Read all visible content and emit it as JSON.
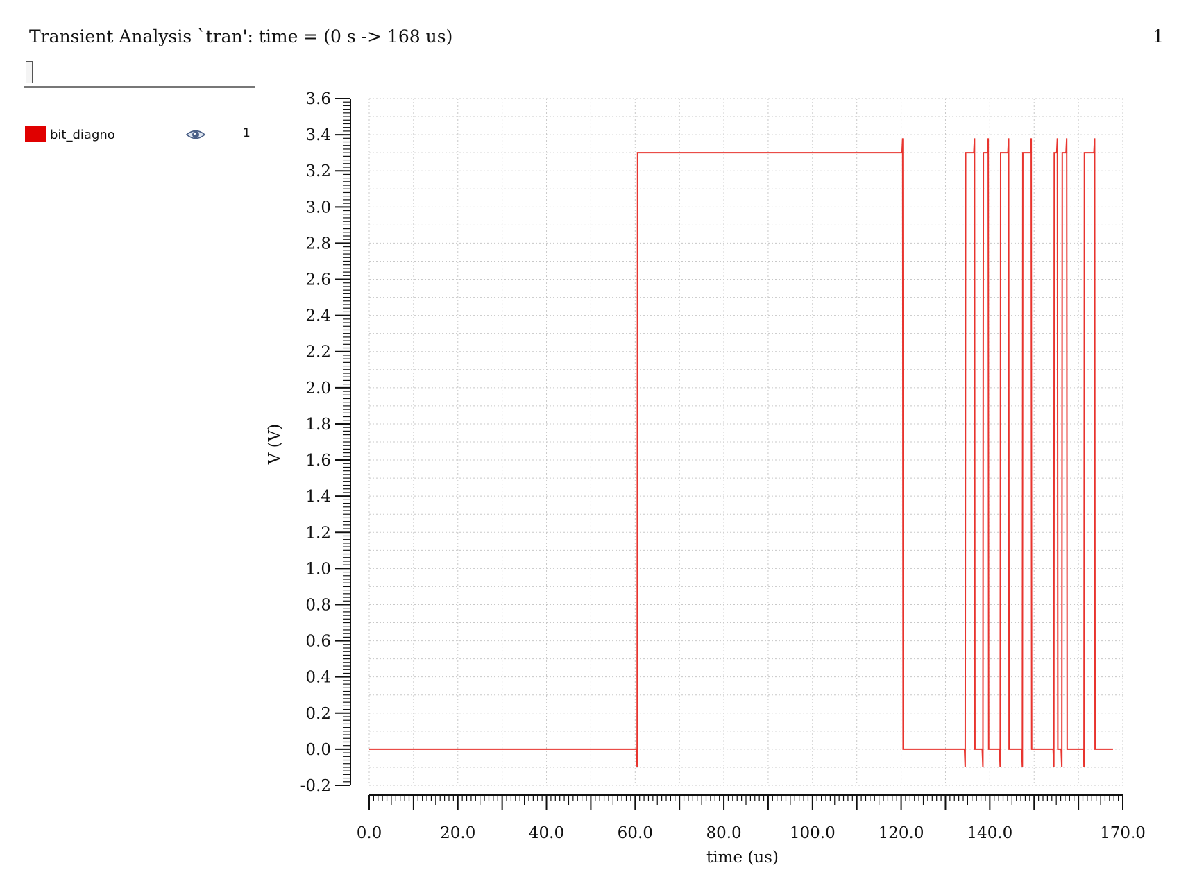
{
  "header": {
    "title": "Transient Analysis `tran': time = (0 s -> 168 us)",
    "page_number": "1"
  },
  "legend": {
    "label": "bit_diagno",
    "index": "1",
    "icon": "eye-icon",
    "color": "#e00000"
  },
  "colors": {
    "trace": "#e8342e",
    "grid": "#c8c8c8",
    "axis": "#111111"
  },
  "chart_data": {
    "type": "line",
    "xlabel": "time (us)",
    "ylabel": "V (V)",
    "xlim": [
      0,
      170
    ],
    "ylim": [
      -0.2,
      3.6
    ],
    "x_ticks": [
      {
        "value": 0,
        "label": "0.0"
      },
      {
        "value": 20,
        "label": "20.0"
      },
      {
        "value": 40,
        "label": "40.0"
      },
      {
        "value": 60,
        "label": "60.0"
      },
      {
        "value": 80,
        "label": "80.0"
      },
      {
        "value": 100,
        "label": "100.0"
      },
      {
        "value": 120,
        "label": "120.0"
      },
      {
        "value": 140,
        "label": "140.0"
      },
      {
        "value": 170,
        "label": "170.0"
      }
    ],
    "y_ticks": [
      {
        "value": 3.6,
        "label": "3.6"
      },
      {
        "value": 3.4,
        "label": "3.4"
      },
      {
        "value": 3.2,
        "label": "3.2"
      },
      {
        "value": 3.0,
        "label": "3.0"
      },
      {
        "value": 2.8,
        "label": "2.8"
      },
      {
        "value": 2.6,
        "label": "2.6"
      },
      {
        "value": 2.4,
        "label": "2.4"
      },
      {
        "value": 2.2,
        "label": "2.2"
      },
      {
        "value": 2.0,
        "label": "2.0"
      },
      {
        "value": 1.8,
        "label": "1.8"
      },
      {
        "value": 1.6,
        "label": "1.6"
      },
      {
        "value": 1.4,
        "label": "1.4"
      },
      {
        "value": 1.2,
        "label": "1.2"
      },
      {
        "value": 1.0,
        "label": "1.0"
      },
      {
        "value": 0.8,
        "label": "0.8"
      },
      {
        "value": 0.6,
        "label": "0.6"
      },
      {
        "value": 0.4,
        "label": "0.4"
      },
      {
        "value": 0.2,
        "label": "0.2"
      },
      {
        "value": 0.0,
        "label": "0.0"
      },
      {
        "value": -0.2,
        "label": "-0.2"
      }
    ],
    "grid": true,
    "series": [
      {
        "name": "bit_diagno",
        "x": [
          0,
          60.3,
          60.45,
          60.55,
          60.7,
          120.2,
          120.35,
          120.45,
          120.6,
          134.3,
          134.45,
          134.55,
          134.7,
          136.4,
          136.55,
          136.65,
          136.8,
          138.3,
          138.45,
          138.55,
          138.7,
          139.5,
          139.65,
          139.75,
          139.9,
          142.2,
          142.35,
          142.45,
          142.6,
          144.1,
          144.25,
          144.35,
          144.5,
          147.2,
          147.35,
          147.45,
          147.6,
          149.2,
          149.35,
          149.45,
          149.6,
          154.3,
          154.45,
          154.55,
          154.7,
          155.1,
          155.25,
          155.35,
          155.5,
          156.1,
          156.25,
          156.35,
          156.5,
          157.2,
          157.35,
          157.45,
          157.6,
          161.2,
          161.25,
          161.35,
          161.5,
          163.5,
          163.65,
          163.75,
          163.9,
          167.8
        ],
        "y": [
          0,
          0,
          -0.1,
          3.3,
          3.3,
          3.3,
          3.38,
          0,
          0,
          0,
          -0.1,
          3.3,
          3.3,
          3.3,
          3.38,
          0,
          0,
          0,
          -0.1,
          3.3,
          3.3,
          3.3,
          3.38,
          0,
          0,
          0,
          -0.1,
          3.3,
          3.3,
          3.3,
          3.38,
          0,
          0,
          0,
          -0.1,
          3.3,
          3.3,
          3.3,
          3.38,
          0,
          0,
          0,
          -0.1,
          3.3,
          3.3,
          3.3,
          3.38,
          0,
          0,
          0,
          -0.1,
          3.3,
          3.3,
          3.3,
          3.38,
          0,
          0,
          0,
          -0.1,
          3.3,
          3.3,
          3.3,
          3.38,
          0,
          0,
          0
        ]
      }
    ]
  }
}
